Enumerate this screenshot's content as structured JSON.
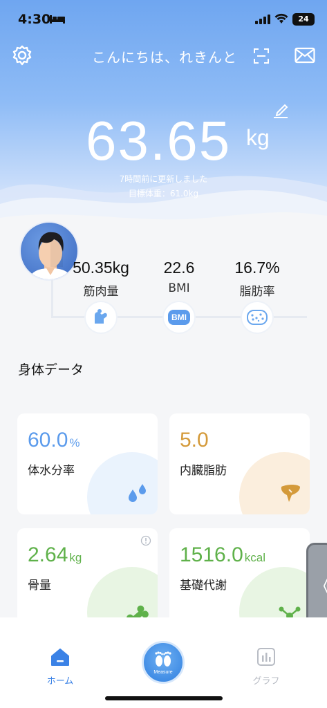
{
  "status": {
    "time": "4:30",
    "battery": "24"
  },
  "header": {
    "greeting": "こんにちは、れきんと"
  },
  "weight": {
    "value": "63.65",
    "unit": "kg",
    "updated": "7時間前に更新しました",
    "target": "目標体重：61.0kg"
  },
  "stats": [
    {
      "value": "50.35kg",
      "label": "筋肉量",
      "icon": "muscle-arm-icon"
    },
    {
      "value": "22.6",
      "label": "BMI",
      "icon": "bmi-icon",
      "badge": "BMI"
    },
    {
      "value": "16.7%",
      "label": "脂肪率",
      "icon": "fat-cells-icon"
    }
  ],
  "section_title": "身体データ",
  "cards": [
    {
      "value": "60.0",
      "unit": "%",
      "label": "体水分率",
      "color": "#5b9bec",
      "icon": "water-drops-icon"
    },
    {
      "value": "5.0",
      "unit": "",
      "label": "内臓脂肪",
      "color": "#d49a3a",
      "icon": "liver-icon"
    },
    {
      "value": "2.64",
      "unit": "kg",
      "label": "骨量",
      "color": "#5fb14a",
      "icon": "bone-icon"
    },
    {
      "value": "1516.0",
      "unit": "kcal",
      "label": "基礎代謝",
      "color": "#5fb14a",
      "icon": "molecule-icon"
    }
  ],
  "side_tab": {
    "glyph": "《"
  },
  "tabbar": {
    "home": "ホーム",
    "measure": "Measure",
    "graph": "グラフ"
  },
  "colors": {
    "accent": "#3b82e6",
    "inactive": "#b8bcc4"
  }
}
